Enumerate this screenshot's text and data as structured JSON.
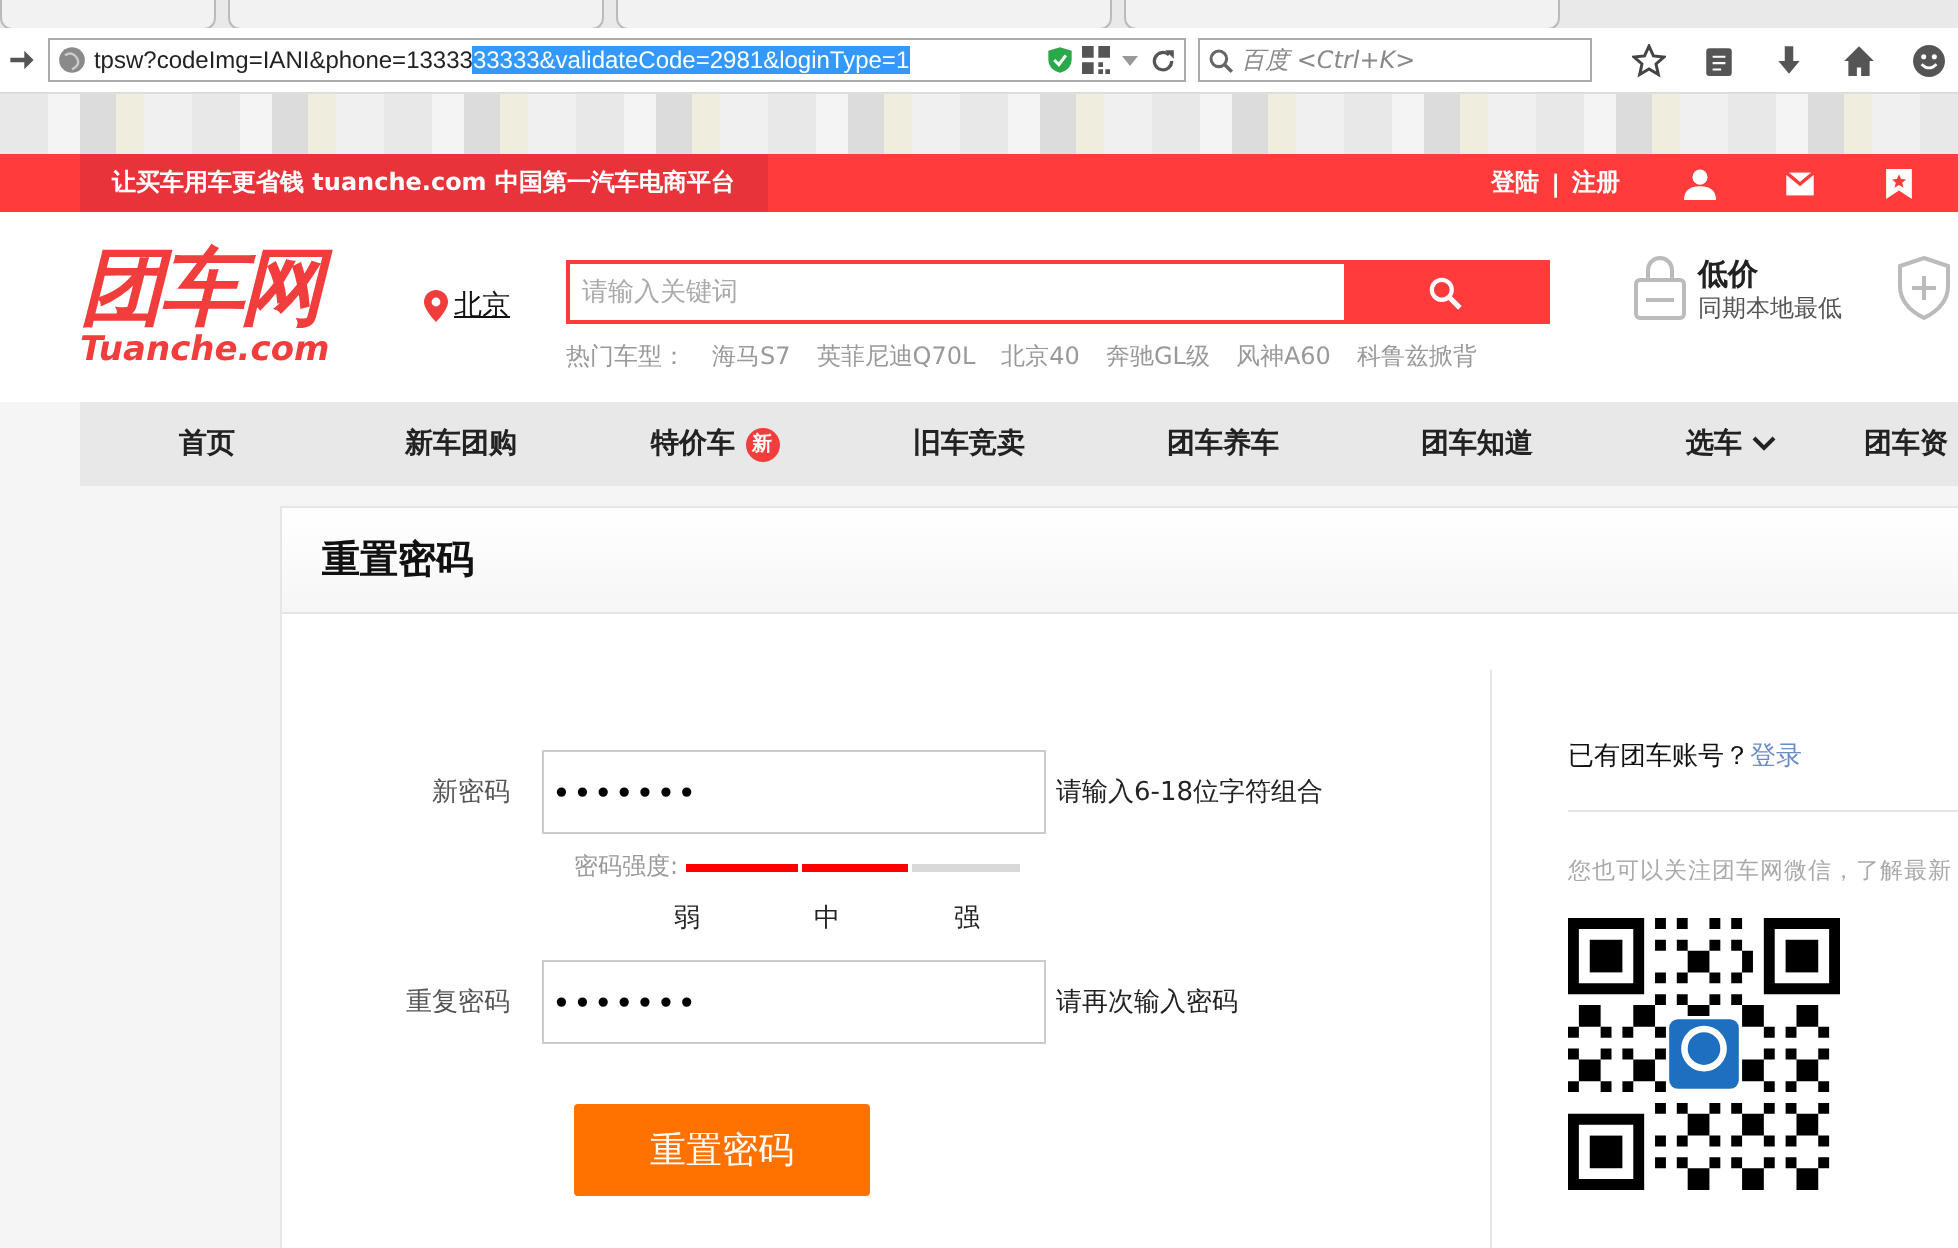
{
  "browser": {
    "url_start": "tpsw?codeImg=IANI&phone=13333",
    "url_selected": "33333&validateCode=2981&loginType=1",
    "search": {
      "placeholder": "百度 <Ctrl+K>"
    }
  },
  "topbar": {
    "slogan": "让买车用车更省钱 tuanche.com 中国第一汽车电商平台",
    "login": "登陆",
    "separator": "|",
    "register": "注册"
  },
  "header": {
    "logo": "团车网",
    "logo_sub": "Tuanche.com",
    "city": "北京",
    "search": {
      "placeholder": "请输入关键词"
    },
    "hot_label": "热门车型：",
    "hot_models": [
      "海马S7",
      "英菲尼迪Q70L",
      "北京40",
      "奔驰GL级",
      "风神A60",
      "科鲁兹掀背"
    ],
    "promo_title": "低价",
    "promo_sub": "同期本地最低"
  },
  "nav": [
    {
      "label": "首页",
      "kind": "plain"
    },
    {
      "label": "新车团购",
      "kind": "plain"
    },
    {
      "label": "特价车",
      "kind": "badge",
      "badge": "新"
    },
    {
      "label": "旧车竞卖",
      "kind": "plain"
    },
    {
      "label": "团车养车",
      "kind": "plain"
    },
    {
      "label": "团车知道",
      "kind": "plain"
    },
    {
      "label": "选车",
      "kind": "dropdown"
    },
    {
      "label": "团车资",
      "kind": "plain"
    }
  ],
  "card": {
    "title": "重置密码",
    "fields": [
      {
        "label": "新密码",
        "value": "•••••••",
        "hint": "请输入6-18位字符组合"
      },
      {
        "label": "重复密码",
        "value": "•••••••",
        "hint": "请再次输入密码"
      }
    ],
    "strength": {
      "label": "密码强度:",
      "level": 0.667,
      "marks": [
        "弱",
        "中",
        "强"
      ]
    },
    "submit": "重置密码"
  },
  "side": {
    "question": "已有团车账号？",
    "login_link": "登录",
    "follow_text": "您也可以关注团车网微信，了解最新"
  }
}
